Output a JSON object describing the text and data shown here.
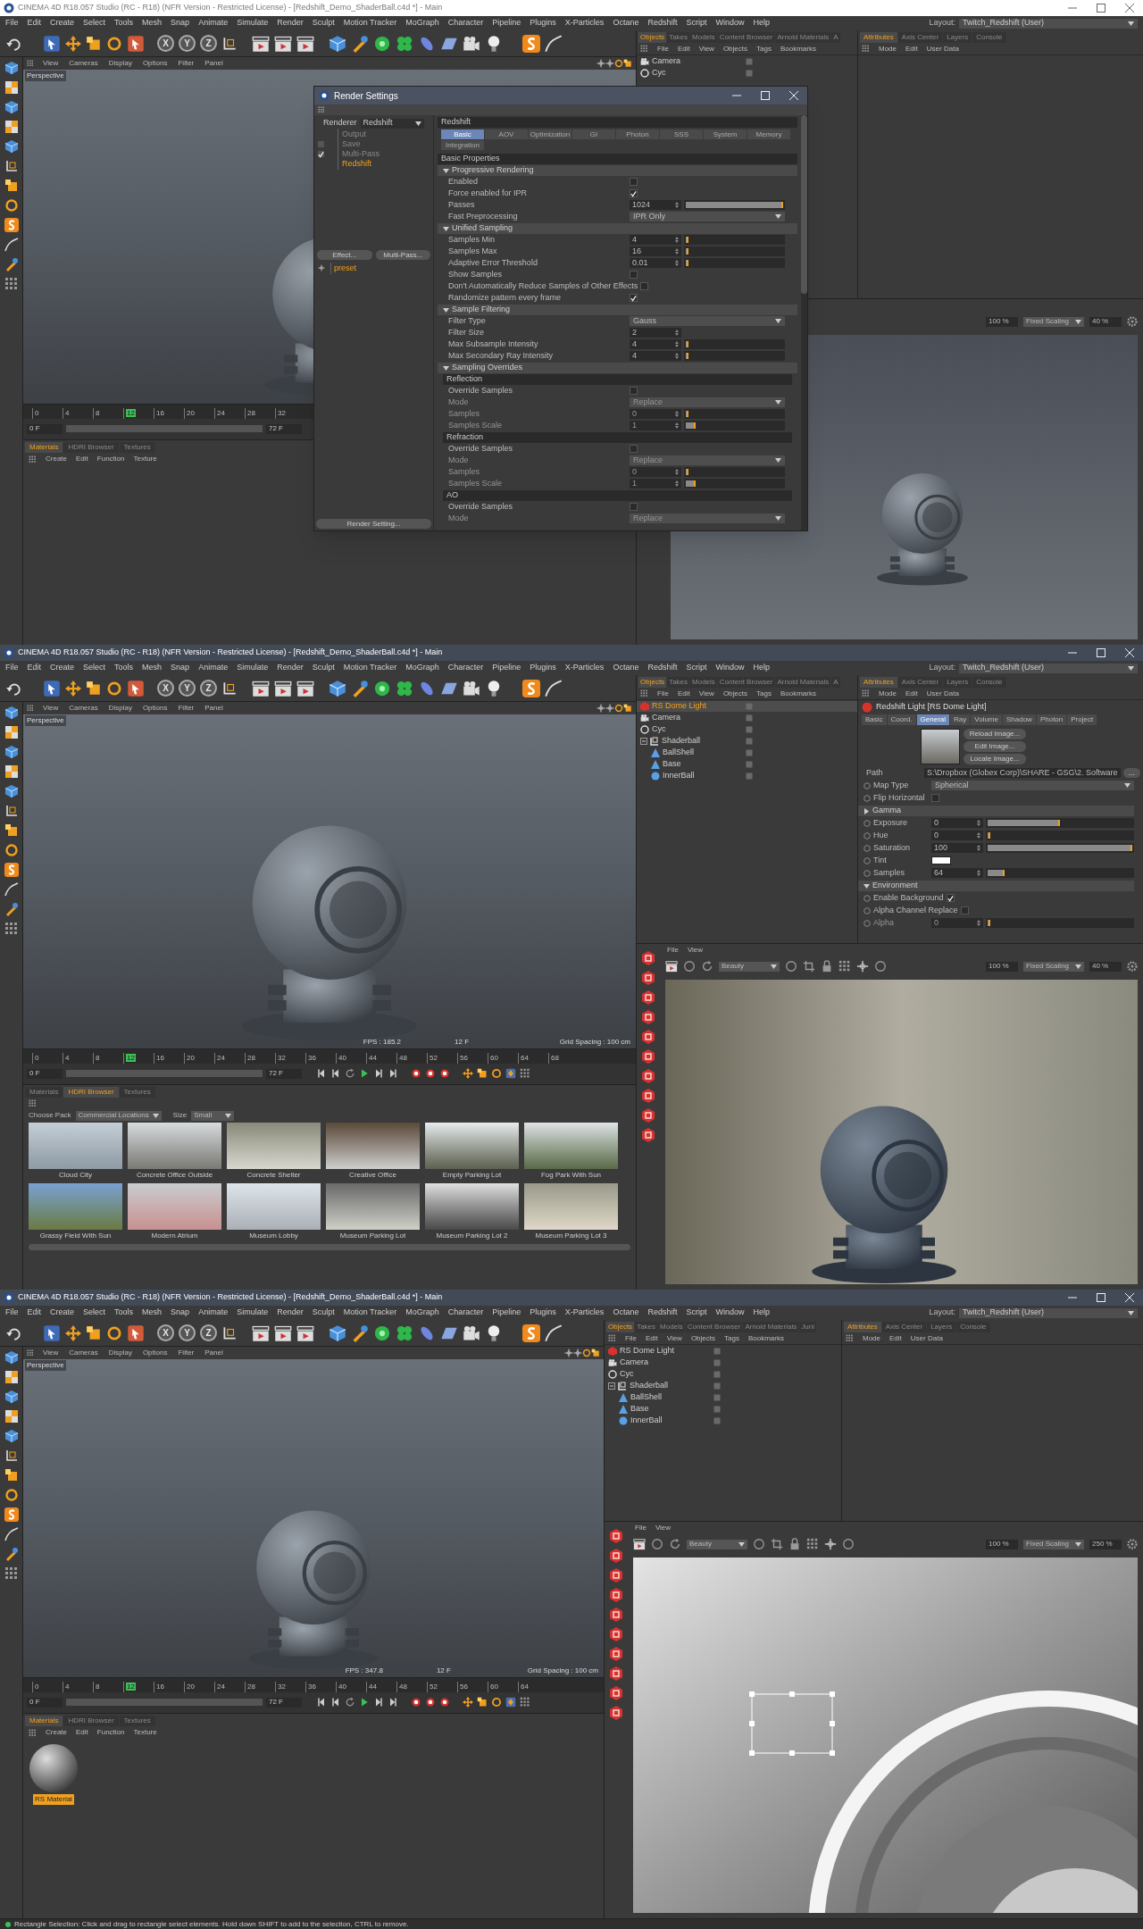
{
  "frames": [
    {
      "window": {
        "title": "CINEMA 4D R18.057 Studio (RC - R18) (NFR Version - Restricted License) - [Redshift_Demo_ShaderBall.c4d *] - Main",
        "active": false
      },
      "menu": [
        "File",
        "Edit",
        "Create",
        "Select",
        "Tools",
        "Mesh",
        "Snap",
        "Animate",
        "Simulate",
        "Render",
        "Sculpt",
        "Motion Tracker",
        "MoGraph",
        "Character",
        "Pipeline",
        "Plugins",
        "X-Particles",
        "Octane",
        "Redshift",
        "Script",
        "Window",
        "Help"
      ],
      "layout": {
        "label": "Layout:",
        "value": "Twitch_Redshift (User)"
      },
      "toolbar": {
        "axes": [
          "X",
          "Y",
          "Z"
        ]
      },
      "viewport": {
        "menu": [
          "View",
          "Cameras",
          "Display",
          "Options",
          "Filter",
          "Panel"
        ],
        "label": "Perspective"
      },
      "timeline": {
        "ticks": [
          {
            "label": "0",
            "selected": false
          },
          {
            "label": "4",
            "selected": false
          },
          {
            "label": "8",
            "selected": false
          },
          {
            "label": "12",
            "selected": true
          },
          {
            "label": "16",
            "selected": false
          },
          {
            "label": "20",
            "selected": false
          },
          {
            "label": "24",
            "selected": false
          },
          {
            "label": "28",
            "selected": false
          },
          {
            "label": "32",
            "selected": false
          }
        ],
        "start": "0 F",
        "end": "72 F",
        "transport": false
      },
      "bottom_panel": {
        "kind": "materials",
        "tabs": [
          {
            "label": "Materials",
            "selected": true
          },
          {
            "label": "HDRI Browser",
            "selected": false
          },
          {
            "label": "Textures",
            "selected": false
          }
        ],
        "menu": [
          "Create",
          "Edit",
          "Function",
          "Texture"
        ]
      },
      "objects_panel": {
        "tabs": [
          {
            "label": "Objects",
            "selected": true
          },
          {
            "label": "Takes",
            "selected": false
          },
          {
            "label": "Models",
            "selected": false
          },
          {
            "label": "Content Browser",
            "selected": false
          },
          {
            "label": "Arnold Materials",
            "selected": false
          },
          {
            "label": "A",
            "selected": false
          }
        ],
        "menu": [
          "File",
          "Edit",
          "View",
          "Objects",
          "Tags",
          "Bookmarks"
        ],
        "objects": [
          {
            "name": "Camera",
            "kind": "camera",
            "selected": false
          },
          {
            "name": "Cyc",
            "kind": "unknown",
            "selected": false
          }
        ]
      },
      "attributes_panel": {
        "tabs": [
          {
            "label": "Attributes",
            "selected": true
          },
          {
            "label": "Axis Center",
            "selected": false
          },
          {
            "label": "Layers",
            "selected": false
          },
          {
            "label": "Console",
            "selected": false
          }
        ],
        "menu": [
          "Mode",
          "Edit",
          "User Data"
        ]
      },
      "render_view": {
        "tool_strip": false,
        "kind": "ball_gray",
        "zoom": "100 %",
        "scaling": "Fixed Scaling",
        "scale": "40 %"
      },
      "render_settings": {
        "title": "Render Settings",
        "renderer_label": "Renderer",
        "renderer": "Redshift",
        "tree": [
          {
            "label": "Output",
            "selected": false
          },
          {
            "label": "Save",
            "selected": false,
            "checked": false
          },
          {
            "label": "Multi-Pass",
            "selected": false,
            "checked": true
          },
          {
            "label": "Redshift",
            "selected": true
          }
        ],
        "buttons": [
          "Effect...",
          "Multi-Pass..."
        ],
        "preset": "preset",
        "footer_button": "Render Setting...",
        "header": "Redshift",
        "tabs": [
          {
            "label": "Basic",
            "selected": true
          },
          {
            "label": "AOV",
            "selected": false
          },
          {
            "label": "Optimization",
            "selected": false
          },
          {
            "label": "GI",
            "selected": false
          },
          {
            "label": "Photon",
            "selected": false
          },
          {
            "label": "SSS",
            "selected": false
          },
          {
            "label": "System",
            "selected": false
          },
          {
            "label": "Memory",
            "selected": false
          },
          {
            "label": "Integration",
            "selected": false
          }
        ],
        "rows": [
          {
            "kind": "section",
            "label": "Basic Properties"
          },
          {
            "kind": "group",
            "label": "Progressive Rendering",
            "expanded": true
          },
          {
            "kind": "checkbox",
            "label": "Enabled",
            "checked": false
          },
          {
            "kind": "checkbox",
            "label": "Force enabled for IPR",
            "checked": true
          },
          {
            "kind": "slider",
            "label": "Passes",
            "value": "1024",
            "level": 1
          },
          {
            "kind": "dropdown",
            "label": "Fast Preprocessing",
            "value": "IPR Only"
          },
          {
            "kind": "group",
            "label": "Unified Sampling",
            "expanded": true
          },
          {
            "kind": "slider",
            "label": "Samples Min",
            "value": "4",
            "level": 0.01
          },
          {
            "kind": "slider",
            "label": "Samples Max",
            "value": "16",
            "level": 0.01
          },
          {
            "kind": "slider",
            "label": "Adaptive Error Threshold",
            "value": "0.01",
            "level": 0.01
          },
          {
            "kind": "checkbox",
            "label": "Show Samples",
            "checked": false
          },
          {
            "kind": "checkbox",
            "label": "Don't Automatically Reduce Samples of Other Effects",
            "checked": false
          },
          {
            "kind": "checkbox",
            "label": "Randomize pattern every frame",
            "checked": true
          },
          {
            "kind": "group",
            "label": "Sample Filtering",
            "expanded": true
          },
          {
            "kind": "dropdown",
            "label": "Filter Type",
            "value": "Gauss"
          },
          {
            "kind": "number",
            "label": "Filter Size",
            "value": "2"
          },
          {
            "kind": "slider",
            "label": "Max Subsample Intensity",
            "value": "4",
            "level": 0.03
          },
          {
            "kind": "slider",
            "label": "Max Secondary Ray Intensity",
            "value": "4",
            "level": 0.03
          },
          {
            "kind": "group",
            "label": "Sampling Overrides",
            "expanded": true
          },
          {
            "kind": "subheader",
            "label": "Reflection"
          },
          {
            "kind": "checkbox",
            "label": "Override Samples",
            "checked": false
          },
          {
            "kind": "dropdown",
            "label": "Mode",
            "value": "Replace",
            "disabled": true
          },
          {
            "kind": "slider",
            "label": "Samples",
            "value": "0",
            "level": 0.01,
            "disabled": true
          },
          {
            "kind": "slider",
            "label": "Samples Scale",
            "value": "1",
            "level": 0.1,
            "disabled": true
          },
          {
            "kind": "subheader",
            "label": "Refraction"
          },
          {
            "kind": "checkbox",
            "label": "Override Samples",
            "checked": false
          },
          {
            "kind": "dropdown",
            "label": "Mode",
            "value": "Replace",
            "disabled": true
          },
          {
            "kind": "slider",
            "label": "Samples",
            "value": "0",
            "level": 0.01,
            "disabled": true
          },
          {
            "kind": "slider",
            "label": "Samples Scale",
            "value": "1",
            "level": 0.1,
            "disabled": true
          },
          {
            "kind": "subheader",
            "label": "AO"
          },
          {
            "kind": "checkbox",
            "label": "Override Samples",
            "checked": false
          },
          {
            "kind": "dropdown",
            "label": "Mode",
            "value": "Replace",
            "disabled": true
          }
        ]
      }
    },
    {
      "window": {
        "title": "CINEMA 4D R18.057 Studio (RC - R18) (NFR Version - Restricted License) - [Redshift_Demo_ShaderBall.c4d *] - Main",
        "active": true
      },
      "menu": [
        "File",
        "Edit",
        "Create",
        "Select",
        "Tools",
        "Mesh",
        "Snap",
        "Animate",
        "Simulate",
        "Render",
        "Sculpt",
        "Motion Tracker",
        "MoGraph",
        "Character",
        "Pipeline",
        "Plugins",
        "X-Particles",
        "Octane",
        "Redshift",
        "Script",
        "Window",
        "Help"
      ],
      "layout": {
        "label": "Layout:",
        "value": "Twitch_Redshift (User)"
      },
      "toolbar": {
        "axes": [
          "X",
          "Y",
          "Z"
        ]
      },
      "viewport": {
        "menu": [
          "View",
          "Cameras",
          "Display",
          "Options",
          "Filter",
          "Panel"
        ],
        "label": "Perspective",
        "hud": {
          "fps": "FPS : 185.2",
          "frame": "12 F",
          "grid": "Grid Spacing : 100 cm"
        }
      },
      "timeline": {
        "ticks": [
          {
            "label": "0",
            "selected": false
          },
          {
            "label": "4",
            "selected": false
          },
          {
            "label": "8",
            "selected": false
          },
          {
            "label": "12",
            "selected": true
          },
          {
            "label": "16",
            "selected": false
          },
          {
            "label": "20",
            "selected": false
          },
          {
            "label": "24",
            "selected": false
          },
          {
            "label": "28",
            "selected": false
          },
          {
            "label": "32",
            "selected": false
          },
          {
            "label": "36",
            "selected": false
          },
          {
            "label": "40",
            "selected": false
          },
          {
            "label": "44",
            "selected": false
          },
          {
            "label": "48",
            "selected": false
          },
          {
            "label": "52",
            "selected": false
          },
          {
            "label": "56",
            "selected": false
          },
          {
            "label": "60",
            "selected": false
          },
          {
            "label": "64",
            "selected": false
          },
          {
            "label": "68",
            "selected": false
          }
        ],
        "start": "0 F",
        "end": "72 F",
        "transport": true
      },
      "bottom_panel": {
        "kind": "hdri",
        "tabs": [
          {
            "label": "Materials",
            "selected": false
          },
          {
            "label": "HDRI Browser",
            "selected": true
          },
          {
            "label": "Textures",
            "selected": false
          }
        ],
        "pack_label": "Choose Pack",
        "pack": "Commercial Locations",
        "size_label": "Size",
        "size": "Small",
        "items": [
          "Cloud City",
          "Concrete Office Outside",
          "Concrete Shelter",
          "Creative Office",
          "Empty Parking Lot",
          "Fog Park With Sun",
          "Grassy Field With Sun",
          "Modern Atrium",
          "Museum Lobby",
          "Museum Parking Lot",
          "Museum Parking Lot 2",
          "Museum Parking Lot 3"
        ]
      },
      "objects_panel": {
        "tabs": [
          {
            "label": "Objects",
            "selected": true
          },
          {
            "label": "Takes",
            "selected": false
          },
          {
            "label": "Models",
            "selected": false
          },
          {
            "label": "Content Browser",
            "selected": false
          },
          {
            "label": "Arnold Materials",
            "selected": false
          },
          {
            "label": "A",
            "selected": false
          }
        ],
        "menu": [
          "File",
          "Edit",
          "View",
          "Objects",
          "Tags",
          "Bookmarks"
        ],
        "objects": [
          {
            "name": "RS Dome Light",
            "kind": "light",
            "selected": true
          },
          {
            "name": "Camera",
            "kind": "camera",
            "selected": false
          },
          {
            "name": "Cyc",
            "kind": "unknown",
            "selected": false
          },
          {
            "name": "Shaderball",
            "kind": "null",
            "selected": false,
            "expanded": true,
            "children": [
              {
                "name": "BallShell",
                "kind": "polygon",
                "selected": false
              },
              {
                "name": "Base",
                "kind": "polygon",
                "selected": false
              },
              {
                "name": "InnerBall",
                "kind": "sphere",
                "selected": false
              }
            ]
          }
        ]
      },
      "attributes_panel": {
        "tabs": [
          {
            "label": "Attributes",
            "selected": true
          },
          {
            "label": "Axis Center",
            "selected": false
          },
          {
            "label": "Layers",
            "selected": false
          },
          {
            "label": "Console",
            "selected": false
          }
        ],
        "menu": [
          "Mode",
          "Edit",
          "User Data"
        ],
        "header": "Redshift Light [RS Dome Light]",
        "object_tabs": [
          {
            "label": "Basic",
            "selected": false
          },
          {
            "label": "Coord.",
            "selected": false
          },
          {
            "label": "General",
            "selected": true
          },
          {
            "label": "Ray",
            "selected": false
          },
          {
            "label": "Volume",
            "selected": false
          },
          {
            "label": "Shadow",
            "selected": false
          },
          {
            "label": "Photon",
            "selected": false
          },
          {
            "label": "Project",
            "selected": false
          }
        ],
        "rows": [
          {
            "kind": "image",
            "buttons": [
              "Reload Image...",
              "Edit Image...",
              "Locate Image..."
            ]
          },
          {
            "kind": "path",
            "label": "Path",
            "value": "S:\\Dropbox (Globex Corp)\\SHARE - GSG\\2. Software",
            "button": "..."
          },
          {
            "kind": "dropdown",
            "label": "Map Type",
            "value": "Spherical"
          },
          {
            "kind": "checkbox",
            "label": "Flip Horizontal",
            "checked": false
          },
          {
            "kind": "group",
            "label": "Gamma",
            "expanded": false
          },
          {
            "kind": "slider",
            "label": "Exposure",
            "value": "0",
            "level": 0.5
          },
          {
            "kind": "slider",
            "label": "Hue",
            "value": "0",
            "level": 0
          },
          {
            "kind": "slider",
            "label": "Saturation",
            "value": "100",
            "level": 1
          },
          {
            "kind": "color",
            "label": "Tint",
            "color": "#ffffff"
          },
          {
            "kind": "slider",
            "label": "Samples",
            "value": "64",
            "level": 0.12
          },
          {
            "kind": "group",
            "label": "Environment",
            "expanded": true
          },
          {
            "kind": "checkbox",
            "label": "Enable Background",
            "checked": true
          },
          {
            "kind": "checkbox",
            "label": "Alpha Channel Replace",
            "checked": false
          },
          {
            "kind": "slider",
            "label": "Alpha",
            "value": "0",
            "level": 0,
            "disabled": true
          }
        ]
      },
      "render_view": {
        "tool_strip": true,
        "kind": "ball_room",
        "menu": [
          "File",
          "View"
        ],
        "pass": "Beauty",
        "zoom": "100 %",
        "scaling": "Fixed Scaling",
        "scale": "40 %"
      }
    },
    {
      "window": {
        "title": "CINEMA 4D R18.057 Studio (RC - R18) (NFR Version - Restricted License) - [Redshift_Demo_ShaderBall.c4d *] - Main",
        "active": true
      },
      "menu": [
        "File",
        "Edit",
        "Create",
        "Select",
        "Tools",
        "Mesh",
        "Snap",
        "Animate",
        "Simulate",
        "Render",
        "Sculpt",
        "Motion Tracker",
        "MoGraph",
        "Character",
        "Pipeline",
        "Plugins",
        "X-Particles",
        "Octane",
        "Redshift",
        "Script",
        "Window",
        "Help"
      ],
      "layout": {
        "label": "Layout:",
        "value": "Twitch_Redshift (User)"
      },
      "toolbar": {
        "axes": [
          "X",
          "Y",
          "Z"
        ]
      },
      "viewport": {
        "menu": [
          "View",
          "Cameras",
          "Display",
          "Options",
          "Filter",
          "Panel"
        ],
        "label": "Perspective",
        "hud": {
          "fps": "FPS : 347.8",
          "frame": "12 F",
          "grid": "Grid Spacing : 100 cm"
        }
      },
      "timeline": {
        "ticks": [
          {
            "label": "0",
            "selected": false
          },
          {
            "label": "4",
            "selected": false
          },
          {
            "label": "8",
            "selected": false
          },
          {
            "label": "12",
            "selected": true
          },
          {
            "label": "16",
            "selected": false
          },
          {
            "label": "20",
            "selected": false
          },
          {
            "label": "24",
            "selected": false
          },
          {
            "label": "28",
            "selected": false
          },
          {
            "label": "32",
            "selected": false
          },
          {
            "label": "36",
            "selected": false
          },
          {
            "label": "40",
            "selected": false
          },
          {
            "label": "44",
            "selected": false
          },
          {
            "label": "48",
            "selected": false
          },
          {
            "label": "52",
            "selected": false
          },
          {
            "label": "56",
            "selected": false
          },
          {
            "label": "60",
            "selected": false
          },
          {
            "label": "64",
            "selected": false
          }
        ],
        "start": "0 F",
        "end": "72 F",
        "transport": true
      },
      "bottom_panel": {
        "kind": "materials",
        "tabs": [
          {
            "label": "Materials",
            "selected": true
          },
          {
            "label": "HDRI Browser",
            "selected": false
          },
          {
            "label": "Textures",
            "selected": false
          }
        ],
        "menu": [
          "Create",
          "Edit",
          "Function",
          "Texture"
        ],
        "materials": [
          {
            "name": "RS Material",
            "selected": true
          }
        ]
      },
      "objects_panel": {
        "tabs": [
          {
            "label": "Objects",
            "selected": true
          },
          {
            "label": "Takes",
            "selected": false
          },
          {
            "label": "Models",
            "selected": false
          },
          {
            "label": "Content Browser",
            "selected": false
          },
          {
            "label": "Arnold Materials",
            "selected": false
          },
          {
            "label": "Juni",
            "selected": false
          }
        ],
        "menu": [
          "File",
          "Edit",
          "View",
          "Objects",
          "Tags",
          "Bookmarks"
        ],
        "objects": [
          {
            "name": "RS Dome Light",
            "kind": "light",
            "selected": false
          },
          {
            "name": "Camera",
            "kind": "camera",
            "selected": false
          },
          {
            "name": "Cyc",
            "kind": "unknown",
            "selected": false
          },
          {
            "name": "Shaderball",
            "kind": "null",
            "selected": false,
            "expanded": true,
            "children": [
              {
                "name": "BallShell",
                "kind": "polygon",
                "selected": false
              },
              {
                "name": "Base",
                "kind": "polygon",
                "selected": false
              },
              {
                "name": "InnerBall",
                "kind": "sphere",
                "selected": false
              }
            ]
          }
        ]
      },
      "attributes_panel": {
        "tabs": [
          {
            "label": "Attributes",
            "selected": true
          },
          {
            "label": "Axis Center",
            "selected": false
          },
          {
            "label": "Layers",
            "selected": false
          },
          {
            "label": "Console",
            "selected": false
          }
        ],
        "menu": [
          "Mode",
          "Edit",
          "User Data"
        ]
      },
      "render_view": {
        "tool_strip": true,
        "kind": "closeup",
        "menu": [
          "File",
          "View"
        ],
        "pass": "Beauty",
        "zoom": "100 %",
        "scaling": "Fixed Scaling",
        "scale": "250 %"
      },
      "status_bar": {
        "text": "Rectangle Selection: Click and drag to rectangle select elements. Hold down SHIFT to add to the selection, CTRL to remove."
      }
    }
  ]
}
